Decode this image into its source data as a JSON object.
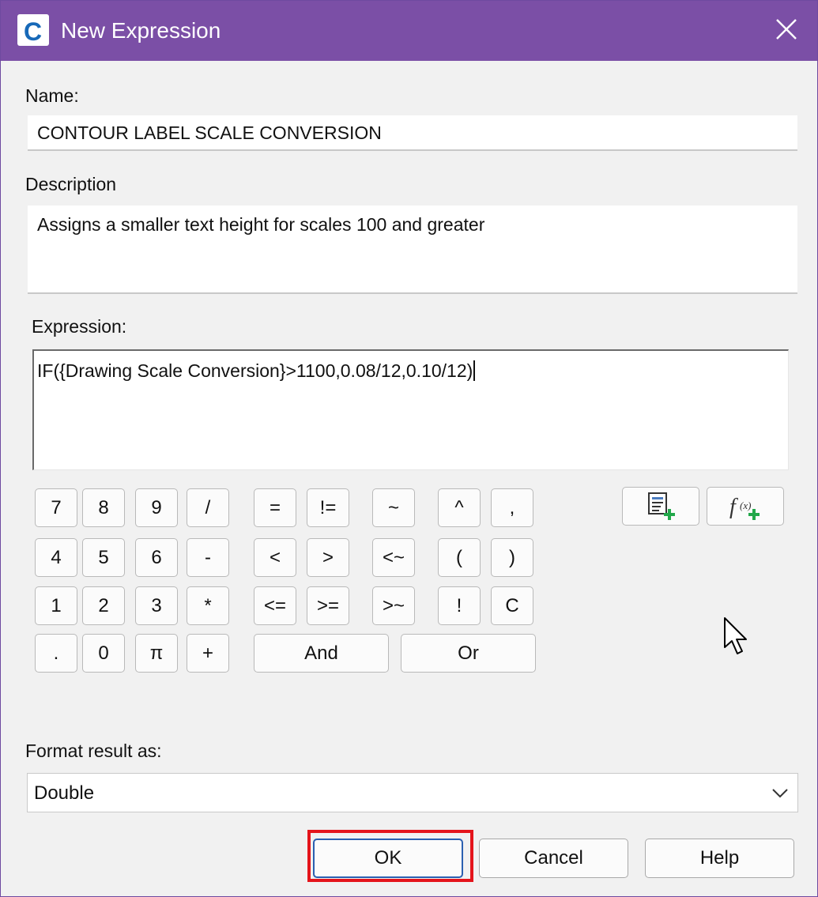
{
  "window": {
    "title": "New Expression",
    "app_icon_letter": "C"
  },
  "name_field": {
    "label": "Name:",
    "value": "CONTOUR LABEL SCALE CONVERSION"
  },
  "description_field": {
    "label": "Description",
    "value": "Assigns a smaller text height for scales 100 and greater"
  },
  "expression_field": {
    "label": "Expression:",
    "value": "IF({Drawing Scale Conversion}>1100,0.08/12,0.10/12)"
  },
  "keypad": {
    "keys": [
      "7",
      "8",
      "9",
      "/",
      "=",
      "!=",
      "~",
      "^",
      ",",
      "4",
      "5",
      "6",
      "-",
      "<",
      ">",
      "<~",
      "(",
      ")",
      "1",
      "2",
      "3",
      "*",
      "<=",
      ">=",
      ">~",
      "!",
      "C",
      ".",
      "0",
      "π",
      "+",
      "And",
      "Or"
    ]
  },
  "tool_buttons": [
    "insert-property-icon",
    "insert-function-icon"
  ],
  "format_result": {
    "label": "Format result as:",
    "value": "Double"
  },
  "buttons": {
    "ok": "OK",
    "cancel": "Cancel",
    "help": "Help"
  },
  "colors": {
    "titlebar": "#7b4fa6",
    "highlight": "#e4141b",
    "accent_green": "#22a84a"
  }
}
